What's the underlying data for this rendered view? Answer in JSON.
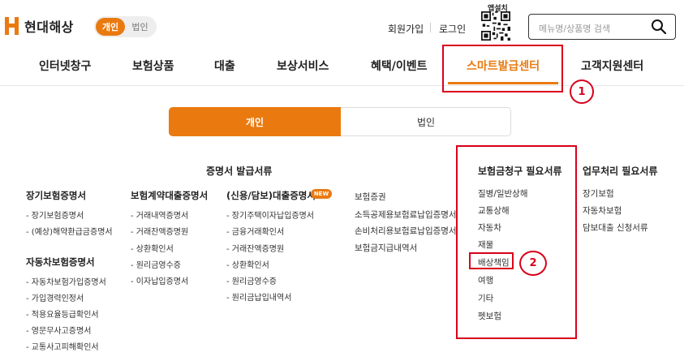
{
  "header": {
    "logo_text": "현대해상",
    "segment": {
      "personal": "개인",
      "corporate": "법인"
    },
    "signup": "회원가입",
    "login": "로그인",
    "app_install": "앱설치",
    "search_placeholder": "메뉴명/상품명 검색"
  },
  "nav": {
    "items": [
      "인터넷창구",
      "보험상품",
      "대출",
      "보상서비스",
      "혜택/이벤트",
      "스마트발급센터",
      "고객지원센터"
    ]
  },
  "tabs": {
    "personal": "개인",
    "corporate": "법인"
  },
  "sections": {
    "certificates_title": "증명서 발급서류",
    "claims_title": "보험금청구 필요서류",
    "business_title": "업무처리 필요서류"
  },
  "col1": {
    "title": "장기보험증명서",
    "items": [
      "장기보험증명서",
      "(예상)해약환급금증명서"
    ],
    "title2": "자동차보험증명서",
    "items2": [
      "자동차보험가입증명서",
      "가입경력인정서",
      "적용요율등급확인서",
      "영문무사고증명서",
      "교통사고피해확인서"
    ]
  },
  "col2": {
    "title": "보험계약대출증명서",
    "items": [
      "거래내역증명서",
      "거래잔액증명원",
      "상환확인서",
      "원리금영수증",
      "이자납입증명서"
    ]
  },
  "col3": {
    "title": "(신용/담보)대출증명서",
    "badge": "NEW",
    "items": [
      "장기주택이자납입증명서",
      "금융거래확인서",
      "거래잔액증명원",
      "상환확인서",
      "원리금영수증",
      "원리금납입내역서"
    ]
  },
  "col4": {
    "items": [
      "보험증권",
      "소득공제용보험료납입증명서",
      "손비처리용보험료납입증명서",
      "보험금지급내역서"
    ]
  },
  "claims": {
    "items": [
      "질병/일반상해",
      "교통상해",
      "자동차",
      "재물",
      "배상책임",
      "여행",
      "기타",
      "펫보험"
    ]
  },
  "business": {
    "items": [
      "장기보험",
      "자동차보험",
      "담보대출 신청서류"
    ]
  },
  "annotations": {
    "one": "1",
    "two": "2"
  },
  "colors": {
    "accent": "#ea7a10",
    "annotation": "#d9001b"
  }
}
